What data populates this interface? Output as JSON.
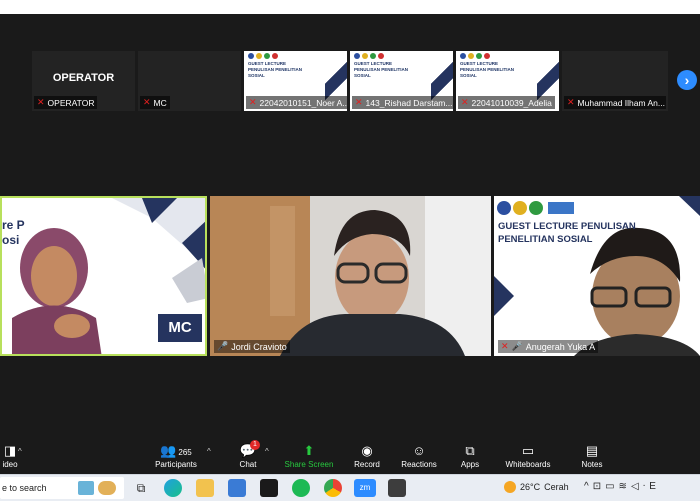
{
  "strip": {
    "operator_big": "OPERATOR",
    "tiles": [
      {
        "name": "OPERATOR"
      },
      {
        "name": "MC"
      },
      {
        "name": "22042010151_Noer A..."
      },
      {
        "name": "143_Rishad Darstam..."
      },
      {
        "name": "22041010039_Adelia"
      },
      {
        "name": "Muhammad Ilham An..."
      }
    ],
    "slide_title": "GUEST LECTURE PENULISAN PENELITIAN SOSIAL",
    "next_icon": "chevron-right-icon"
  },
  "videos": {
    "mc_slide_text": "re P\nosi",
    "mc_badge": "MC",
    "jordi_label": "Jordi Cravioto",
    "anugerah_label": "Anugerah Yuka A",
    "anugerah_slide_title": "GUEST LECTURE PENULISAN\nPENELITIAN SOSIAL",
    "active_speaker_color": "#b8e05c"
  },
  "controls": {
    "video": "ideo",
    "participants": "Participants",
    "participants_count": "265",
    "chat": "Chat",
    "chat_badge": "1",
    "share_screen": "Share Screen",
    "record": "Record",
    "reactions": "Reactions",
    "apps": "Apps",
    "whiteboards": "Whiteboards",
    "notes": "Notes"
  },
  "taskbar": {
    "search": "e to search",
    "weather_temp": "26°C",
    "weather_desc": "Cerah",
    "zoom_label": "zm",
    "edge_text": "E"
  }
}
